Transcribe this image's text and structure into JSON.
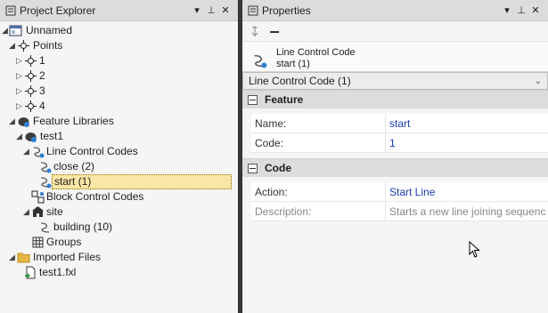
{
  "explorer": {
    "title": "Project Explorer",
    "controls": {
      "menu": "▾",
      "pin": "⊥",
      "close": "✕"
    },
    "tree": {
      "root": "Unnamed",
      "points": "Points",
      "point_items": [
        "1",
        "2",
        "3",
        "4"
      ],
      "feature_libraries": "Feature Libraries",
      "library": "test1",
      "line_control_codes": "Line Control Codes",
      "close": "close (2)",
      "start": "start (1)",
      "block_control_codes": "Block Control Codes",
      "site": "site",
      "building": "building (10)",
      "groups": "Groups",
      "imported_files": "Imported Files",
      "file": "test1.fxl"
    }
  },
  "properties": {
    "title": "Properties",
    "controls": {
      "menu": "▾",
      "pin": "⊥",
      "close": "✕"
    },
    "object": {
      "type": "Line Control Code",
      "name": "start (1)"
    },
    "selector": "Line Control Code (1)",
    "categories": {
      "feature": {
        "label": "Feature",
        "name_key": "Name:",
        "name_val": "start",
        "code_key": "Code:",
        "code_val": "1"
      },
      "code": {
        "label": "Code",
        "action_key": "Action:",
        "action_val": "Start Line",
        "desc_key": "Description:",
        "desc_val": "Starts a new line joining sequenc"
      }
    }
  },
  "colors": {
    "selection": "#fbe6a6",
    "value_text": "#1a3db5",
    "splitter": "#3a3a3a"
  }
}
